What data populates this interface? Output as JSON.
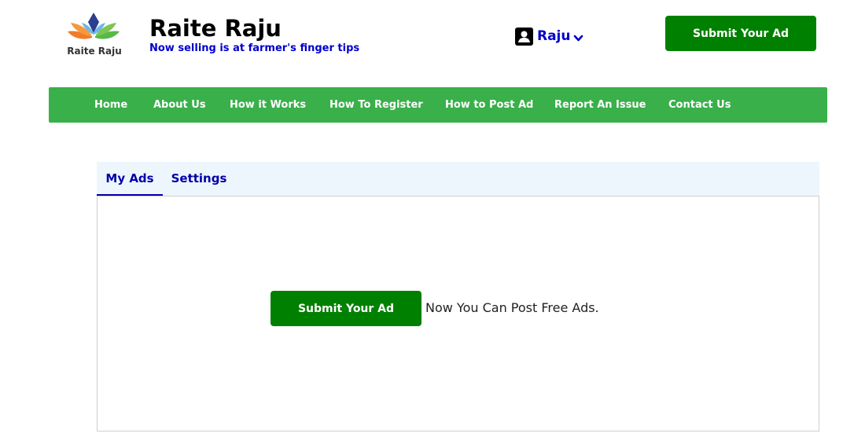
{
  "header": {
    "logo_text": "Raite Raju",
    "title": "Raite Raju",
    "tagline": "Now selling is at farmer's finger tips",
    "user_name": "Raju",
    "submit_label": "Submit Your Ad"
  },
  "nav": {
    "items": [
      {
        "label": "Home"
      },
      {
        "label": "About Us"
      },
      {
        "label": "How it Works"
      },
      {
        "label": "How To Register"
      },
      {
        "label": "How to Post Ad"
      },
      {
        "label": "Report An Issue"
      },
      {
        "label": "Contact Us"
      }
    ]
  },
  "tabs": [
    {
      "label": "My Ads",
      "active": true
    },
    {
      "label": "Settings",
      "active": false
    }
  ],
  "content": {
    "submit_label": "Submit Your Ad",
    "message": "Now You Can Post Free Ads."
  },
  "colors": {
    "nav_green": "#39b04a",
    "button_green": "#008000",
    "link_blue": "#0000cc",
    "tabbar_bg": "#eef6fd"
  },
  "icons": {
    "logo": "lotus-leaves-logo",
    "user": "user-profile-icon",
    "dropdown": "chevron-down-icon"
  }
}
